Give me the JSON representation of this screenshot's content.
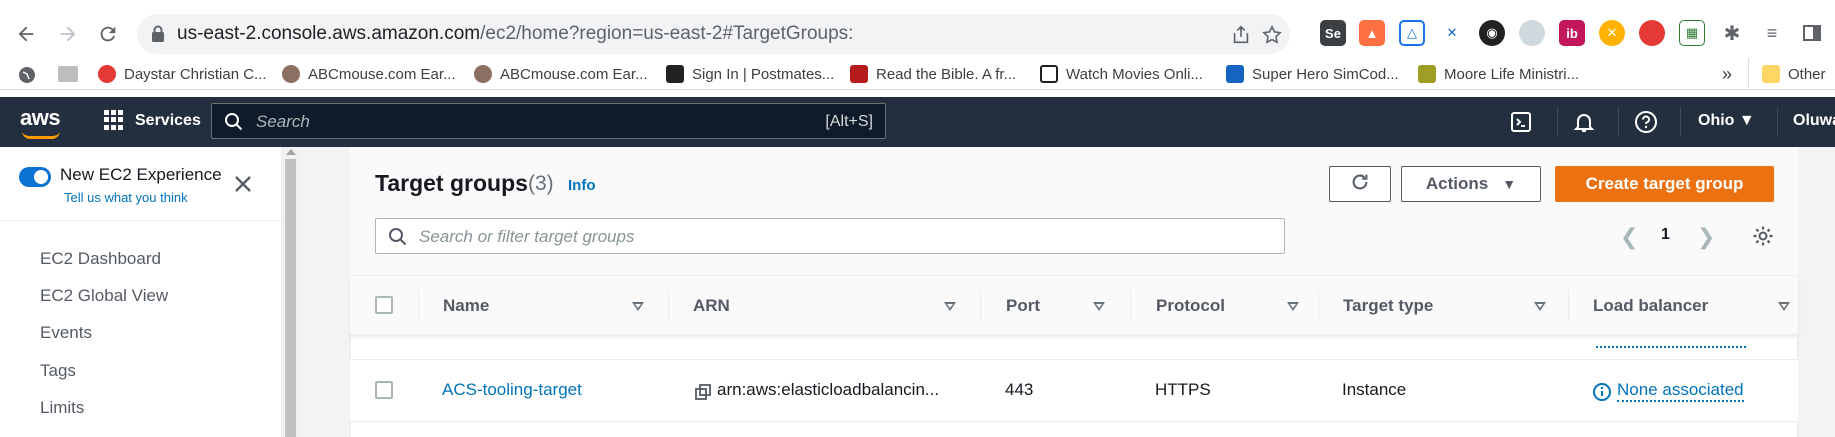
{
  "browser": {
    "url_host": "us-east-2.console.aws.amazon.com",
    "url_path": "/ec2/home?region=us-east-2#TargetGroups:",
    "bookmarks": [
      {
        "label": "Daystar Christian C...",
        "color": "#e53935"
      },
      {
        "label": "ABCmouse.com Ear...",
        "color": "#8d6e63"
      },
      {
        "label": "ABCmouse.com Ear...",
        "color": "#8d6e63"
      },
      {
        "label": "Sign In | Postmates...",
        "color": "#222222"
      },
      {
        "label": "Read the Bible. A fr...",
        "color": "#b71c1c"
      },
      {
        "label": "Watch Movies Onli...",
        "color": "#222222"
      },
      {
        "label": "Super Hero SimCod...",
        "color": "#1565c0"
      },
      {
        "label": "Moore Life Ministri...",
        "color": "#9e9d24"
      }
    ],
    "overflow": "»",
    "other_bookmarks": "Other"
  },
  "aws": {
    "logo": "aws",
    "services": "Services",
    "search_placeholder": "Search",
    "search_shortcut": "[Alt+S]",
    "region": "Ohio",
    "user": "Oluwa"
  },
  "sidenav": {
    "new_experience": "New EC2 Experience",
    "tell_us": "Tell us what you think",
    "items": [
      "EC2 Dashboard",
      "EC2 Global View",
      "Events",
      "Tags",
      "Limits"
    ]
  },
  "main": {
    "title": "Target groups",
    "count": "(3)",
    "info": "Info",
    "actions": "Actions",
    "create": "Create target group",
    "filter_placeholder": "Search or filter target groups",
    "page": "1"
  },
  "table": {
    "headers": [
      "Name",
      "ARN",
      "Port",
      "Protocol",
      "Target type",
      "Load balancer"
    ],
    "rows": [
      {
        "name": "ACS-tooling-target",
        "arn": "arn:aws:elasticloadbalancin...",
        "port": "443",
        "protocol": "HTTPS",
        "target_type": "Instance",
        "load_balancer": "None associated"
      }
    ]
  },
  "colors": {
    "aws_header": "#232f3e",
    "primary": "#ec7211",
    "link": "#0073bb"
  }
}
